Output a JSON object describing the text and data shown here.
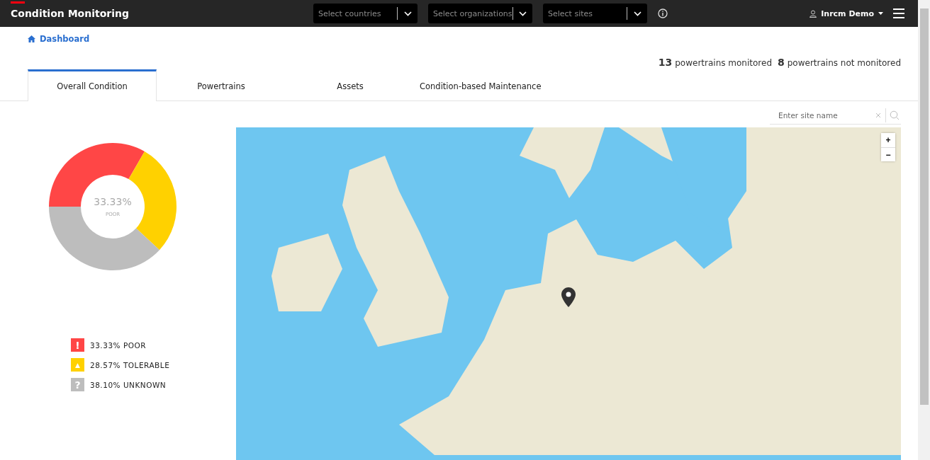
{
  "header": {
    "title": "Condition Monitoring",
    "filters": [
      {
        "placeholder": "Select countries"
      },
      {
        "placeholder": "Select organizations"
      },
      {
        "placeholder": "Select sites"
      }
    ],
    "user": "Inrcm Demo"
  },
  "breadcrumb": "Dashboard",
  "summary": [
    {
      "count": "13",
      "label": "powertrains monitored"
    },
    {
      "count": "8",
      "label": "powertrains not monitored"
    }
  ],
  "tabs": [
    {
      "label": "Overall Condition",
      "selected": true
    },
    {
      "label": "Powertrains",
      "selected": false
    },
    {
      "label": "Assets",
      "selected": false
    },
    {
      "label": "Condition-based Maintenance",
      "selected": false
    }
  ],
  "site_search": {
    "placeholder": "Enter site name"
  },
  "condition": {
    "center_value": "33.33%",
    "center_label": "POOR",
    "legend": [
      {
        "kind": "poor",
        "symbol": "!",
        "value": "33.33%",
        "label": "POOR",
        "color": "#ff4646"
      },
      {
        "kind": "tolerable",
        "symbol": "▲",
        "value": "28.57%",
        "label": "TOLERABLE",
        "color": "#ffd100"
      },
      {
        "kind": "unknown",
        "symbol": "?",
        "value": "38.10%",
        "label": "UNKNOWN",
        "color": "#bdbdbd"
      }
    ]
  },
  "map": {
    "zoom_in": "+",
    "zoom_out": "−"
  }
}
